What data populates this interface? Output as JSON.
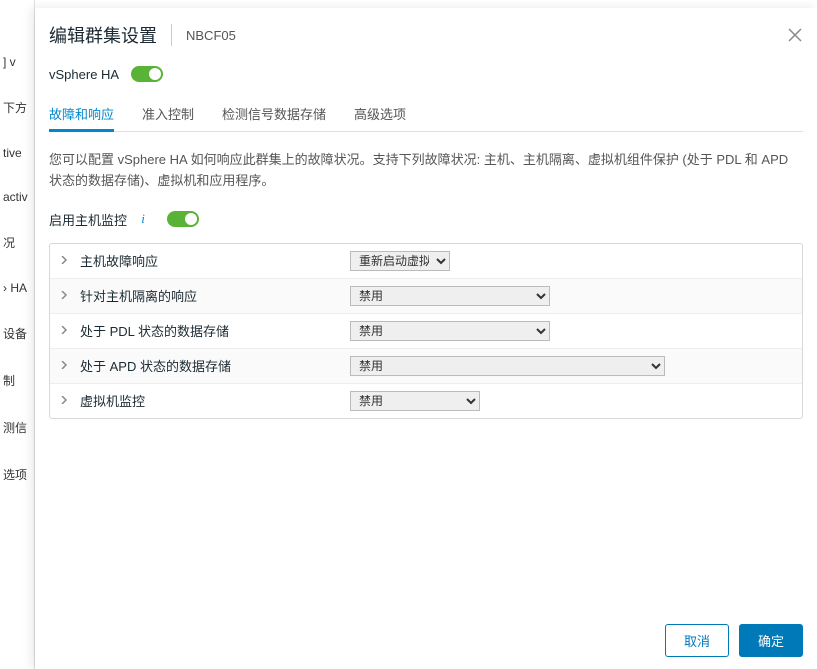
{
  "modal": {
    "title": "编辑群集设置",
    "subtitle": "NBCF05"
  },
  "ha": {
    "label": "vSphere HA"
  },
  "tabs": [
    "故障和响应",
    "准入控制",
    "检测信号数据存储",
    "高级选项"
  ],
  "description": "您可以配置 vSphere HA 如何响应此群集上的故障状况。支持下列故障状况: 主机、主机隔离、虚拟机组件保护 (处于 PDL 和 APD 状态的数据存储)、虚拟机和应用程序。",
  "hostMonitor": {
    "label": "启用主机监控"
  },
  "settings": [
    {
      "label": "主机故障响应",
      "value": "重新启动虚拟机",
      "width": "select-w100"
    },
    {
      "label": "针对主机隔离的响应",
      "value": "禁用",
      "width": "select-w200"
    },
    {
      "label": "处于 PDL 状态的数据存储",
      "value": "禁用",
      "width": "select-w200"
    },
    {
      "label": "处于 APD 状态的数据存储",
      "value": "禁用",
      "width": "select-w315"
    },
    {
      "label": "虚拟机监控",
      "value": "禁用",
      "width": "select-w130"
    }
  ],
  "footer": {
    "cancel": "取消",
    "ok": "确定"
  },
  "background": {
    "sidebar": [
      "] v",
      "下方",
      "tive",
      "activ",
      "况",
      "› HA",
      "设备",
      "制",
      "测信",
      "选项"
    ]
  }
}
